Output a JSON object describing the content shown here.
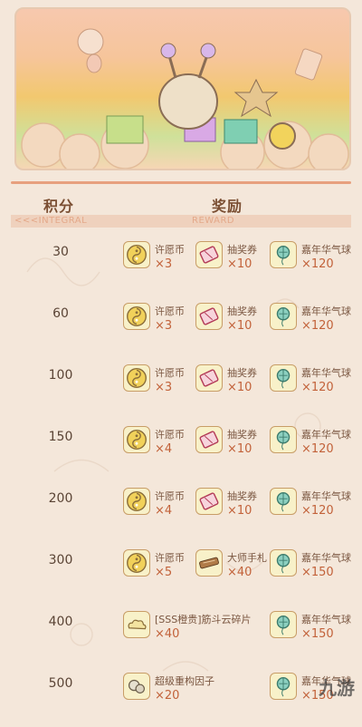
{
  "header": {
    "score_label": "积分",
    "reward_label": "奖励",
    "score_sub": "<<<INTEGRAL",
    "reward_sub": "REWARD"
  },
  "rows": [
    {
      "score": "30",
      "items": [
        {
          "name": "许愿币",
          "qty": "×3"
        },
        {
          "name": "抽奖券",
          "qty": "×10"
        },
        {
          "name": "嘉年华气球",
          "qty": "×120"
        }
      ]
    },
    {
      "score": "60",
      "items": [
        {
          "name": "许愿币",
          "qty": "×3"
        },
        {
          "name": "抽奖券",
          "qty": "×10"
        },
        {
          "name": "嘉年华气球",
          "qty": "×120"
        }
      ]
    },
    {
      "score": "100",
      "items": [
        {
          "name": "许愿币",
          "qty": "×3"
        },
        {
          "name": "抽奖券",
          "qty": "×10"
        },
        {
          "name": "嘉年华气球",
          "qty": "×120"
        }
      ]
    },
    {
      "score": "150",
      "items": [
        {
          "name": "许愿币",
          "qty": "×4"
        },
        {
          "name": "抽奖券",
          "qty": "×10"
        },
        {
          "name": "嘉年华气球",
          "qty": "×120"
        }
      ]
    },
    {
      "score": "200",
      "items": [
        {
          "name": "许愿币",
          "qty": "×4"
        },
        {
          "name": "抽奖券",
          "qty": "×10"
        },
        {
          "name": "嘉年华气球",
          "qty": "×120"
        }
      ]
    },
    {
      "score": "300",
      "items": [
        {
          "name": "许愿币",
          "qty": "×5"
        },
        {
          "name": "大师手札",
          "qty": "×40"
        },
        {
          "name": "嘉年华气球",
          "qty": "×150"
        }
      ]
    },
    {
      "score": "400",
      "items": [
        {
          "name": "[SSS橙贵]筋斗云碎片",
          "qty": "×40"
        },
        {
          "name": "嘉年华气球",
          "qty": "×150"
        }
      ]
    },
    {
      "score": "500",
      "items": [
        {
          "name": "超级重构因子",
          "qty": "×20"
        },
        {
          "name": "嘉年华气球",
          "qty": "×150"
        }
      ]
    }
  ],
  "icons": {
    "coin": "wish-coin-icon",
    "ticket": "lottery-ticket-icon",
    "balloon": "carnival-balloon-icon",
    "notes": "master-notes-icon",
    "cloud": "cloud-fragment-icon",
    "factor": "refactor-factor-icon"
  },
  "watermark": "九游"
}
